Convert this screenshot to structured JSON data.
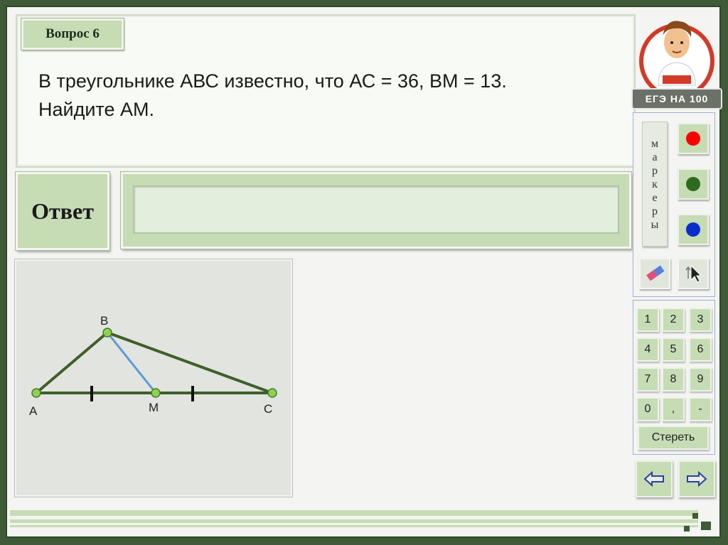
{
  "question": {
    "tab_label": "Вопрос 6",
    "line1": "В треугольнике АВС известно, что АС = 36, ВМ = 13.",
    "line2": "Найдите АМ."
  },
  "answer": {
    "label": "Ответ",
    "value": ""
  },
  "figure": {
    "points": {
      "A": "A",
      "B": "B",
      "M": "M",
      "C": "C"
    },
    "colors": {
      "sides": "#3f5f2a",
      "median": "#5b9bd5",
      "vertex": "#8fd14f"
    }
  },
  "logo": {
    "text": "ЕГЭ НА 100"
  },
  "tools": {
    "markers_label": [
      "м",
      "а",
      "р",
      "к",
      "е",
      "р",
      "ы"
    ],
    "marker_colors": {
      "red": "#ff0000",
      "green": "#2e6b1e",
      "blue": "#0a2ecc"
    },
    "eraser_icon": "eraser-icon",
    "pointer_icon": "pointer-icon"
  },
  "keypad": {
    "keys": [
      "1",
      "2",
      "3",
      "4",
      "5",
      "6",
      "7",
      "8",
      "9",
      "0",
      ",",
      "-"
    ],
    "clear_label": "Стереть"
  },
  "nav": {
    "prev_icon": "arrow-left-icon",
    "next_icon": "arrow-right-icon"
  }
}
